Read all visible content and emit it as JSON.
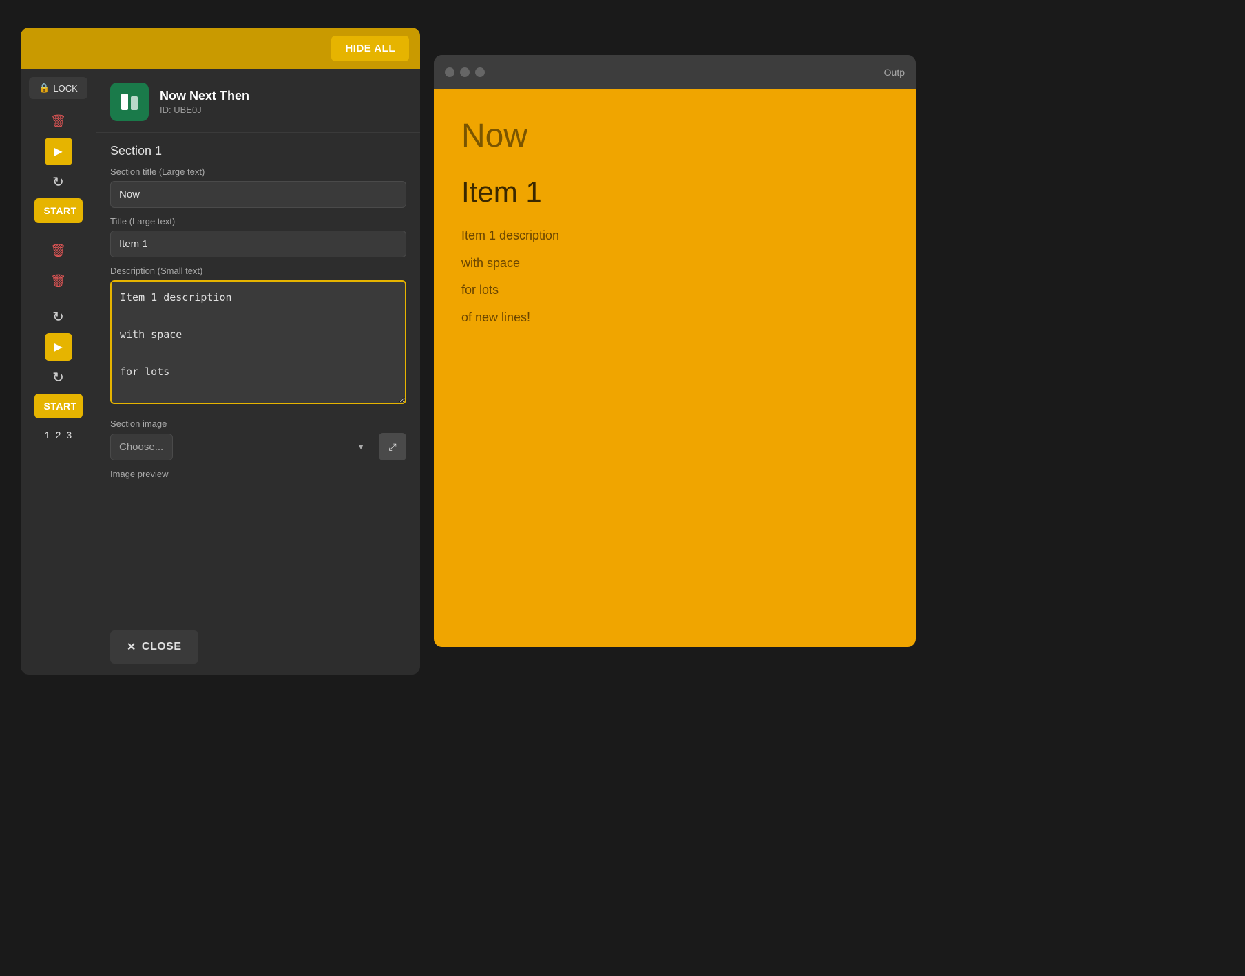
{
  "editorWindow": {
    "hideAllLabel": "HIDE ALL",
    "lockLabel": "LOCK",
    "startLabel": "START",
    "appIcon": "📋",
    "appName": "Now Next Then",
    "appId": "ID: UBE0J",
    "sectionTitle": "Section 1",
    "sectionTitleFieldLabel": "Section title (Large text)",
    "sectionTitleValue": "Now",
    "titleFieldLabel": "Title (Large text)",
    "titleValue": "Item 1",
    "descriptionFieldLabel": "Description (Small text)",
    "descriptionValue": "Item 1 description\n\nwith space\n\nfor lots\n\nof new lines!",
    "sectionImageLabel": "Section image",
    "imagePlaceholder": "Choose...",
    "imagePreviewLabel": "Image preview",
    "closeLabel": "CLOSE",
    "pageNumbers": [
      "1",
      "2",
      "3"
    ]
  },
  "outputWindow": {
    "title": "Outp",
    "sectionTitle": "Now",
    "itemTitle": "Item 1",
    "descriptionLines": [
      "Item 1 description",
      "with space",
      "for lots",
      "of new lines!"
    ]
  },
  "colors": {
    "gold": "#e6b400",
    "darkBg": "#2d2d2d",
    "outputBg": "#f0a500",
    "deleteRed": "#e05555"
  },
  "icons": {
    "lock": "🔒",
    "play": "▶",
    "refresh": "↻",
    "delete": "🗑",
    "close": "✕",
    "expand": "⤢"
  }
}
